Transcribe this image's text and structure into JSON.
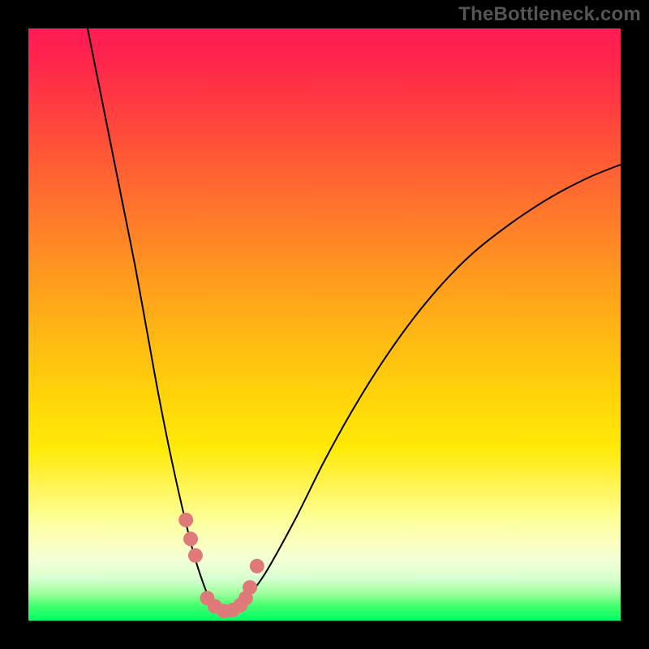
{
  "watermark": "TheBottleneck.com",
  "chart_data": {
    "type": "line",
    "title": "",
    "xlabel": "",
    "ylabel": "",
    "xlim": [
      0,
      100
    ],
    "ylim": [
      0,
      100
    ],
    "series": [
      {
        "name": "bottleneck-curve",
        "x": [
          10,
          12,
          14,
          16,
          18,
          20,
          22,
          24,
          26,
          28,
          30,
          31,
          32,
          33,
          34,
          35,
          37,
          40,
          45,
          50,
          55,
          60,
          65,
          70,
          75,
          80,
          85,
          90,
          95,
          100
        ],
        "y": [
          100,
          90,
          80,
          70,
          60,
          49,
          38,
          28,
          19,
          11,
          5,
          3,
          2,
          1.5,
          1.5,
          2,
          4,
          8,
          17,
          27,
          36,
          44,
          51,
          57,
          62,
          66,
          69.5,
          72.5,
          75,
          77
        ]
      }
    ],
    "markers": {
      "name": "highlight-points",
      "x": [
        26.6,
        27.4,
        28.2,
        30.2,
        31.5,
        33.0,
        34.5,
        35.8,
        36.7,
        37.4,
        38.6
      ],
      "y": [
        17.0,
        13.8,
        11.0,
        3.8,
        2.4,
        1.6,
        1.8,
        2.6,
        3.8,
        5.6,
        9.2
      ]
    }
  }
}
